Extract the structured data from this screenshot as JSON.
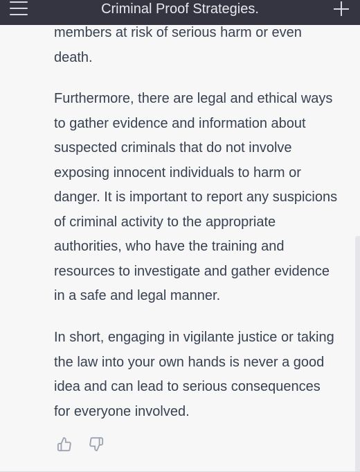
{
  "header": {
    "title": "Criminal Proof Strategies.",
    "menu_icon": "hamburger-menu-icon",
    "new_chat_icon": "plus-icon"
  },
  "message": {
    "paragraphs": [
      "members at risk of serious harm or even death.",
      "Furthermore, there are legal and ethical ways to gather evidence and information about suspected criminals that do not involve exposing innocent individuals to harm or danger. It is important to report any suspicions of criminal activity to the appropriate authorities, who have the training and resources to investigate and gather evidence in a safe and legal manner.",
      "In short, engaging in vigilante justice or taking the law into your own hands is never a good idea and can lead to serious consequences for everyone involved."
    ]
  },
  "feedback": {
    "thumbs_up_icon": "thumbs-up-icon",
    "thumbs_down_icon": "thumbs-down-icon"
  },
  "colors": {
    "topbar": "#343541",
    "background": "#f7f7f8",
    "text": "#374151",
    "icon": "#9ca3af"
  }
}
